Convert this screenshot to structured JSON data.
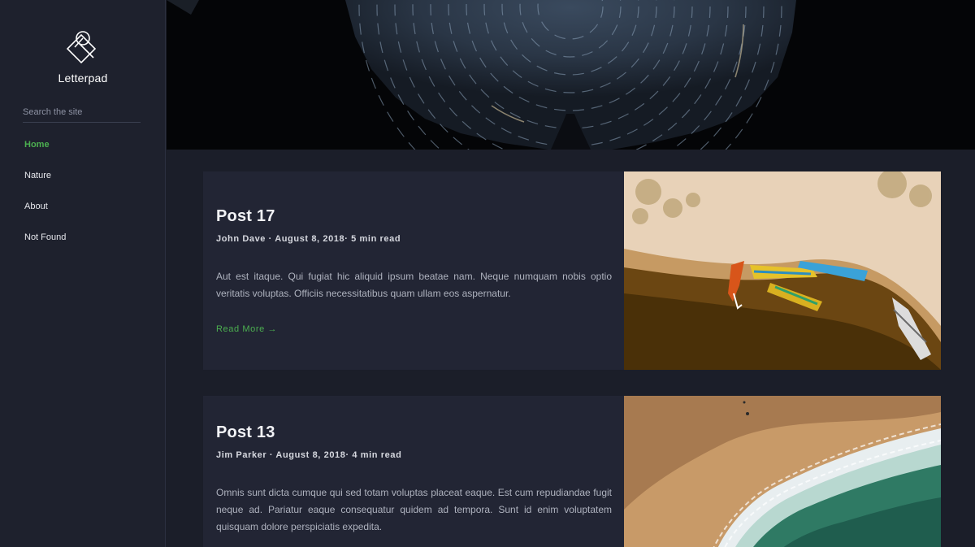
{
  "brand": {
    "name": "Letterpad",
    "logo_icon": "logo-icon"
  },
  "search": {
    "placeholder": "Search the site",
    "value": ""
  },
  "nav": {
    "items": [
      {
        "label": "Home",
        "active": true
      },
      {
        "label": "Nature",
        "active": false
      },
      {
        "label": "About",
        "active": false
      },
      {
        "label": "Not Found",
        "active": false
      }
    ]
  },
  "posts": [
    {
      "title": "Post 17",
      "meta": "John Dave · August 8, 2018· 5 min read",
      "excerpt": "Aut est itaque. Qui fugiat hic aliquid ipsum beatae nam. Neque numquam nobis optio veritatis voluptas. Officiis necessitatibus quam ullam eos aspernatur.",
      "read_more": "Read More →"
    },
    {
      "title": "Post 13",
      "meta": "Jim Parker · August 8, 2018· 4 min read",
      "excerpt": "Omnis sunt dicta cumque qui sed totam voluptas placeat eaque. Est cum repudiandae fugit neque ad. Pariatur eaque consequatur quidem ad tempora. Sunt id enim voluptatem quisquam dolore perspiciatis expedita."
    }
  ],
  "colors": {
    "accent": "#4caf50",
    "sidebar_bg": "#1e212d",
    "page_bg": "#1b1e29",
    "card_bg": "#222534"
  }
}
